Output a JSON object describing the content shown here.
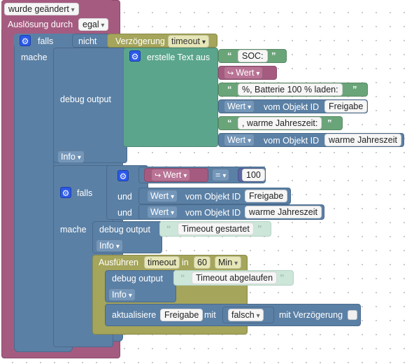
{
  "trigger": {
    "mode_dropdown": "wurde geändert",
    "ausloesung_label": "Auslösung durch",
    "ausloesung_dropdown": "egal"
  },
  "if_block": {
    "falls": "falls",
    "mache": "mache",
    "nicht": "nicht",
    "verzoegerung_label": "Verzögerung",
    "verzoegerung_dropdown": "timeout"
  },
  "debug1": {
    "label": "debug output",
    "level": "Info",
    "create_text_label": "erstelle Text aus",
    "text_soc": "SOC:",
    "wert_var": "Wert",
    "text_batterie": "%, Batterie 100 % laden:",
    "wert_dropdown_1": "Wert",
    "vom_objekt_id": "vom Objekt ID",
    "objekt_freigabe": "Freigabe",
    "text_warme": ", warme Jahreszeit:",
    "wert_dropdown_2": "Wert",
    "objekt_warme": "warme Jahreszeit"
  },
  "if2": {
    "falls": "falls",
    "und1": "und",
    "und2": "und",
    "mache": "mache",
    "compare_var": "Wert",
    "operator": "=",
    "compare_value": "100",
    "cond2_wert": "Wert",
    "cond2_label": "vom Objekt ID",
    "cond2_object": "Freigabe",
    "cond3_wert": "Wert",
    "cond3_label": "vom Objekt ID",
    "cond3_object": "warme Jahreszeit"
  },
  "debug2": {
    "label": "debug output",
    "text": "Timeout gestartet",
    "level": "Info"
  },
  "timeout_block": {
    "ausfuehren": "Ausführen",
    "name": "timeout",
    "in": "in",
    "duration": "60",
    "unit": "Min"
  },
  "debug3": {
    "label": "debug output",
    "text": "Timeout abgelaufen",
    "level": "Info"
  },
  "update_block": {
    "label": "aktualisiere",
    "object": "Freigabe",
    "mit": "mit",
    "value": "falsch",
    "delay_label": "mit Verzögerung"
  },
  "icons": {
    "gear": "gear-icon",
    "var_arrow": "variable-arrow-icon",
    "quote": "quote-icon",
    "dropdown": "chevron-down-icon"
  },
  "colors": {
    "trigger": "#a55b80",
    "logic": "#5b80a5",
    "text": "#5ba58c",
    "timeout": "#a5a55b",
    "gear": "#2b59ea"
  }
}
